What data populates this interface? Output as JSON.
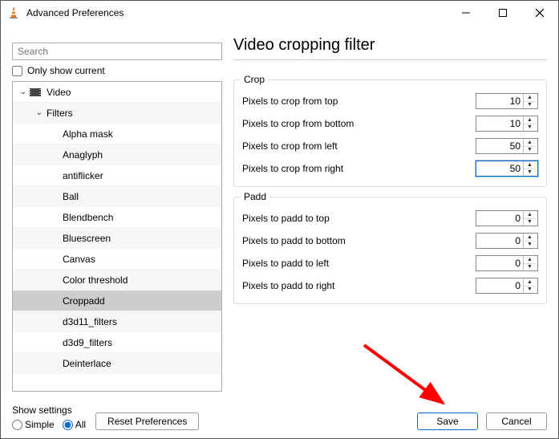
{
  "window": {
    "title": "Advanced Preferences"
  },
  "search": {
    "placeholder": "Search"
  },
  "only_show_current": {
    "label": "Only show current",
    "checked": false
  },
  "tree": {
    "video": {
      "label": "Video",
      "expanded": true
    },
    "filters": {
      "label": "Filters",
      "expanded": true
    },
    "items": [
      {
        "label": "Alpha mask"
      },
      {
        "label": "Anaglyph"
      },
      {
        "label": "antiflicker"
      },
      {
        "label": "Ball"
      },
      {
        "label": "Blendbench"
      },
      {
        "label": "Bluescreen"
      },
      {
        "label": "Canvas"
      },
      {
        "label": "Color threshold"
      },
      {
        "label": "Croppadd",
        "selected": true
      },
      {
        "label": "d3d11_filters"
      },
      {
        "label": "d3d9_filters"
      },
      {
        "label": "Deinterlace"
      }
    ]
  },
  "page": {
    "title": "Video cropping filter"
  },
  "crop": {
    "legend": "Crop",
    "top": {
      "label": "Pixels to crop from top",
      "value": "10"
    },
    "bottom": {
      "label": "Pixels to crop from bottom",
      "value": "10"
    },
    "left": {
      "label": "Pixels to crop from left",
      "value": "50"
    },
    "right": {
      "label": "Pixels to crop from right",
      "value": "50"
    }
  },
  "padd": {
    "legend": "Padd",
    "top": {
      "label": "Pixels to padd to top",
      "value": "0"
    },
    "bottom": {
      "label": "Pixels to padd to bottom",
      "value": "0"
    },
    "left": {
      "label": "Pixels to padd to left",
      "value": "0"
    },
    "right": {
      "label": "Pixels to padd to right",
      "value": "0"
    }
  },
  "bottom": {
    "show_settings_label": "Show settings",
    "simple": "Simple",
    "all": "All",
    "reset": "Reset Preferences",
    "save": "Save",
    "cancel": "Cancel"
  },
  "annotation": {
    "arrow_color": "#ff0000"
  }
}
